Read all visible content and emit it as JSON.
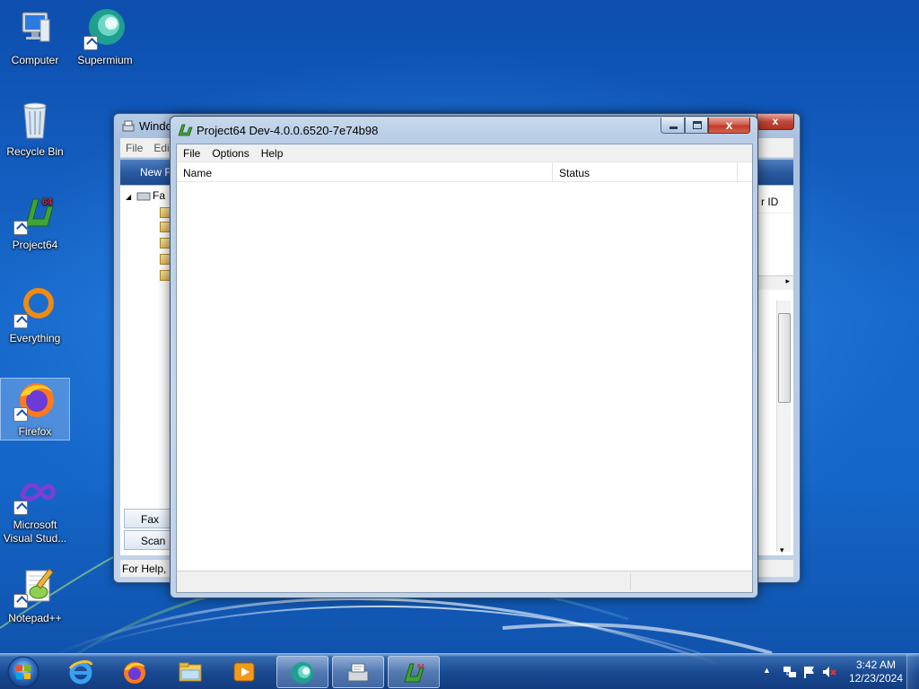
{
  "desktop": {
    "icons": [
      {
        "label": "Computer"
      },
      {
        "label": "Supermium"
      },
      {
        "label": "Recycle Bin"
      },
      {
        "label": "Project64"
      },
      {
        "label": "Everything"
      },
      {
        "label": "Firefox"
      },
      {
        "label": "Microsoft\nVisual Stud..."
      },
      {
        "label": "Notepad++"
      }
    ]
  },
  "back_window": {
    "title": "Windo",
    "menu": [
      "File",
      "Edi"
    ],
    "toolbar_label": "New F",
    "tree_root": "Fa",
    "column_header": "r ID",
    "nav": [
      "Fax",
      "Scan"
    ],
    "status": "For Help, p",
    "close_label": "x"
  },
  "p64": {
    "title": "Project64 Dev-4.0.0.6520-7e74b98",
    "menu": [
      "File",
      "Options",
      "Help"
    ],
    "columns": [
      "Name",
      "Status"
    ],
    "close_label": "x"
  },
  "taskbar": {
    "clock_time": "3:42 AM",
    "clock_date": "12/23/2024",
    "tray_chevron": "▲",
    "pinned": [
      "start-orb",
      "internet-explorer",
      "firefox",
      "windows-explorer",
      "media-player",
      "supermium",
      "fax-and-scan",
      "project64"
    ]
  },
  "colors": {
    "wallpaper": "#1769cc",
    "p64_close": "#c13c28",
    "taskbar": "#1e4a8e"
  }
}
